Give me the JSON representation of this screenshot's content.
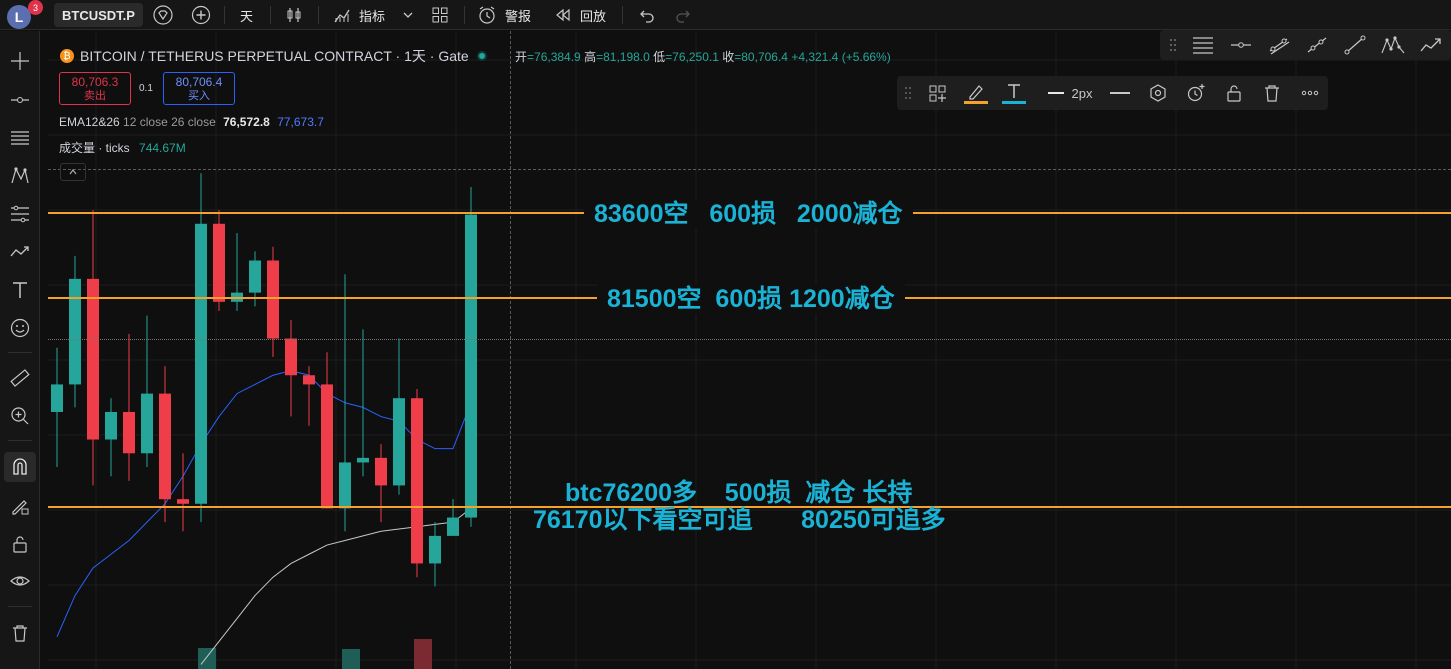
{
  "topbar": {
    "avatar_letter": "L",
    "badge_count": "3",
    "symbol": "BTCUSDT.P",
    "interval": "天",
    "indicators_label": "指标",
    "alert_label": "警报",
    "replay_label": "回放"
  },
  "header": {
    "title": "BITCOIN / TETHERUS PERPETUAL CONTRACT · 1天 · Gate",
    "open_label": "开",
    "open_value": "=76,384.9",
    "high_label": "高",
    "high_value": "=81,198.0",
    "low_label": "低",
    "low_value": "=76,250.1",
    "close_label": "收",
    "close_value": "=80,706.4",
    "change": "+4,321.4 (+5.66%)"
  },
  "trade": {
    "sell_price": "80,706.3",
    "sell_label": "卖出",
    "spread": "0.1",
    "buy_price": "80,706.4",
    "buy_label": "买入"
  },
  "indicators": {
    "ema_name": "EMA12&26",
    "ema_params": "12 close 26 close",
    "ema_val1": "76,572.8",
    "ema_val2": "77,673.7",
    "vol_name": "成交量 · ticks",
    "vol_value": "744.67M"
  },
  "style_panel": {
    "width_label": "2px"
  },
  "annotations": {
    "line1": "83600空   600损   2000减仓",
    "line2": "81500空  600损 1200减仓",
    "line3a": "btc76200多    500损  减仓 长持",
    "line3b": "76170以下看空可追       80250可追多"
  },
  "colors": {
    "up": "#26a69a",
    "down": "#ef3e4a",
    "level_line": "#f5a12a",
    "annotation": "#1ab3d6",
    "ema12": "#2962ff",
    "ema26": "#c8c8c8"
  },
  "chart_data": {
    "type": "candlestick",
    "candles": [
      {
        "o": 76400,
        "h": 77800,
        "l": 75200,
        "c": 77000
      },
      {
        "o": 77000,
        "h": 79800,
        "l": 76500,
        "c": 79300
      },
      {
        "o": 79300,
        "h": 80800,
        "l": 74800,
        "c": 75800
      },
      {
        "o": 75800,
        "h": 76700,
        "l": 75000,
        "c": 76400
      },
      {
        "o": 76400,
        "h": 78100,
        "l": 74900,
        "c": 75500
      },
      {
        "o": 75500,
        "h": 78500,
        "l": 75200,
        "c": 76800
      },
      {
        "o": 76800,
        "h": 77400,
        "l": 74000,
        "c": 74500
      },
      {
        "o": 74500,
        "h": 75500,
        "l": 73800,
        "c": 74400
      },
      {
        "o": 74400,
        "h": 81600,
        "l": 74000,
        "c": 80500
      },
      {
        "o": 80500,
        "h": 80800,
        "l": 78600,
        "c": 78800
      },
      {
        "o": 78800,
        "h": 80300,
        "l": 78600,
        "c": 79000
      },
      {
        "o": 79000,
        "h": 79900,
        "l": 78700,
        "c": 79700
      },
      {
        "o": 79700,
        "h": 80000,
        "l": 77600,
        "c": 78000
      },
      {
        "o": 78000,
        "h": 78400,
        "l": 76300,
        "c": 77200
      },
      {
        "o": 77200,
        "h": 77400,
        "l": 76100,
        "c": 77000
      },
      {
        "o": 77000,
        "h": 77700,
        "l": 74300,
        "c": 74300
      },
      {
        "o": 74300,
        "h": 79400,
        "l": 73800,
        "c": 75300
      },
      {
        "o": 75300,
        "h": 78200,
        "l": 75000,
        "c": 75400
      },
      {
        "o": 75400,
        "h": 75700,
        "l": 74000,
        "c": 74800
      },
      {
        "o": 74800,
        "h": 78000,
        "l": 74600,
        "c": 76700
      },
      {
        "o": 76700,
        "h": 76900,
        "l": 72800,
        "c": 73100
      },
      {
        "o": 73100,
        "h": 74000,
        "l": 72600,
        "c": 73700
      },
      {
        "o": 73700,
        "h": 74500,
        "l": 73800,
        "c": 74100
      },
      {
        "o": 74100,
        "h": 81300,
        "l": 73900,
        "c": 80700
      }
    ],
    "ema12": [
      null,
      null,
      null,
      null,
      null,
      null,
      null,
      null,
      null,
      null,
      null,
      null,
      77200,
      77300,
      77200,
      76800,
      76600,
      76500,
      76300,
      76200,
      75800,
      75600,
      75600,
      76600
    ],
    "ema26": [
      null,
      null,
      null,
      null,
      null,
      null,
      null,
      null,
      null,
      null,
      null,
      null,
      null,
      null,
      null,
      null,
      null,
      null,
      null,
      null,
      null,
      null,
      74000,
      74300
    ],
    "ylim": [
      70800,
      84700
    ]
  }
}
